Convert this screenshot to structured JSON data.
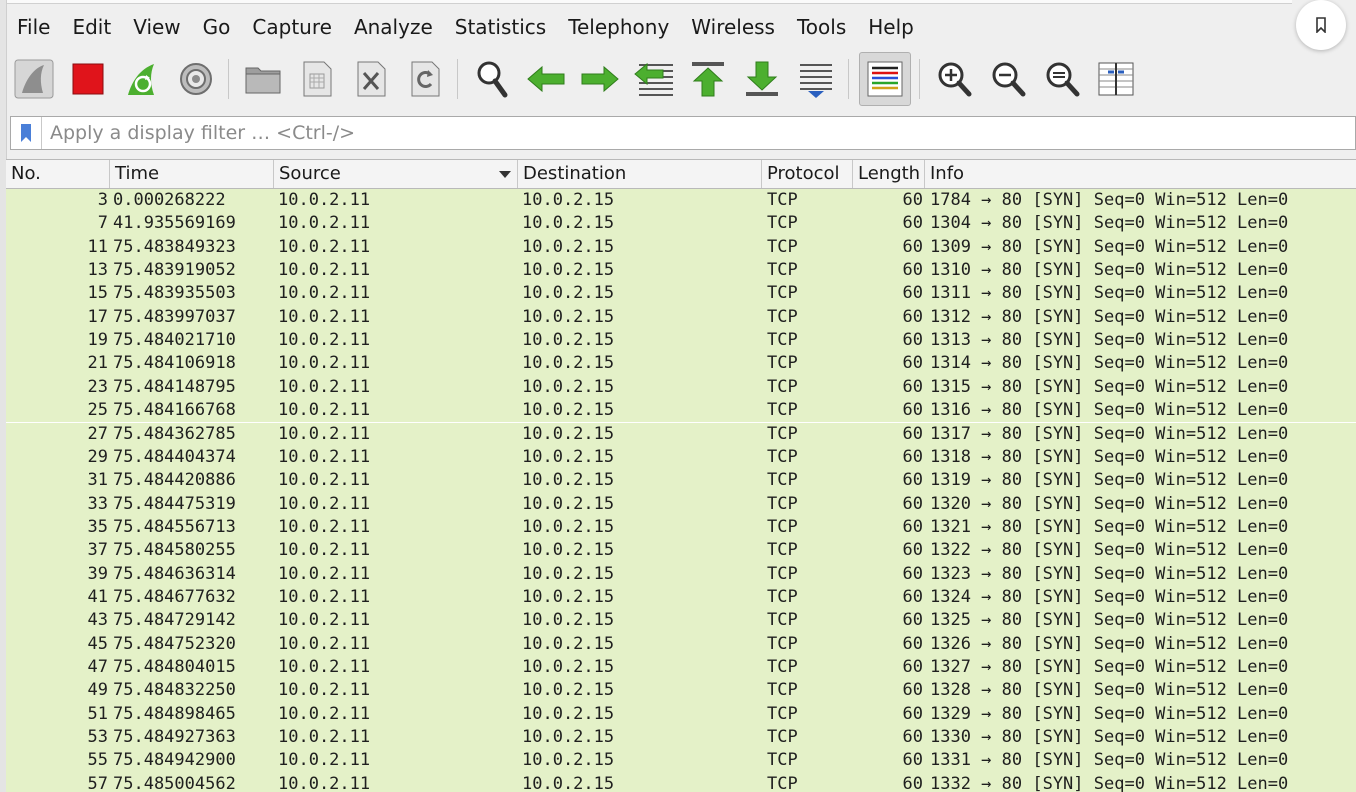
{
  "menu": [
    "File",
    "Edit",
    "View",
    "Go",
    "Capture",
    "Analyze",
    "Statistics",
    "Telephony",
    "Wireless",
    "Tools",
    "Help"
  ],
  "toolbar": {
    "buttons": [
      {
        "name": "start-capture-fin-icon",
        "sep": false
      },
      {
        "name": "stop-capture-icon",
        "sep": false
      },
      {
        "name": "restart-capture-icon",
        "sep": false
      },
      {
        "name": "capture-options-gear-icon",
        "sep": true
      },
      {
        "name": "open-file-folder-icon",
        "sep": false
      },
      {
        "name": "save-file-icon",
        "sep": false
      },
      {
        "name": "close-file-icon",
        "sep": false
      },
      {
        "name": "reload-file-icon",
        "sep": true
      },
      {
        "name": "find-packet-search-icon",
        "sep": false
      },
      {
        "name": "go-back-arrow-icon",
        "sep": false
      },
      {
        "name": "go-forward-arrow-icon",
        "sep": false
      },
      {
        "name": "go-to-packet-icon",
        "sep": false
      },
      {
        "name": "go-first-packet-icon",
        "sep": false
      },
      {
        "name": "go-last-packet-icon",
        "sep": false
      },
      {
        "name": "auto-scroll-icon",
        "sep": true
      },
      {
        "name": "colorize-icon",
        "sep": true,
        "pressed": true
      },
      {
        "name": "zoom-in-icon",
        "sep": false
      },
      {
        "name": "zoom-out-icon",
        "sep": false
      },
      {
        "name": "zoom-normal-icon",
        "sep": false
      },
      {
        "name": "resize-columns-icon",
        "sep": false
      }
    ]
  },
  "filter": {
    "placeholder": "Apply a display filter … <Ctrl-/>"
  },
  "columns": {
    "no": "No.",
    "time": "Time",
    "source": "Source",
    "destination": "Destination",
    "protocol": "Protocol",
    "length": "Length",
    "info": "Info"
  },
  "colors": {
    "row_bg": "#e4f1c8"
  },
  "packets": [
    {
      "no": "3",
      "time": "0.000268222",
      "src": "10.0.2.11",
      "dst": "10.0.2.15",
      "proto": "TCP",
      "len": "60",
      "info": "1784 → 80 [SYN] Seq=0 Win=512 Len=0"
    },
    {
      "no": "7",
      "time": "41.935569169",
      "src": "10.0.2.11",
      "dst": "10.0.2.15",
      "proto": "TCP",
      "len": "60",
      "info": "1304 → 80 [SYN] Seq=0 Win=512 Len=0"
    },
    {
      "no": "11",
      "time": "75.483849323",
      "src": "10.0.2.11",
      "dst": "10.0.2.15",
      "proto": "TCP",
      "len": "60",
      "info": "1309 → 80 [SYN] Seq=0 Win=512 Len=0"
    },
    {
      "no": "13",
      "time": "75.483919052",
      "src": "10.0.2.11",
      "dst": "10.0.2.15",
      "proto": "TCP",
      "len": "60",
      "info": "1310 → 80 [SYN] Seq=0 Win=512 Len=0"
    },
    {
      "no": "15",
      "time": "75.483935503",
      "src": "10.0.2.11",
      "dst": "10.0.2.15",
      "proto": "TCP",
      "len": "60",
      "info": "1311 → 80 [SYN] Seq=0 Win=512 Len=0"
    },
    {
      "no": "17",
      "time": "75.483997037",
      "src": "10.0.2.11",
      "dst": "10.0.2.15",
      "proto": "TCP",
      "len": "60",
      "info": "1312 → 80 [SYN] Seq=0 Win=512 Len=0"
    },
    {
      "no": "19",
      "time": "75.484021710",
      "src": "10.0.2.11",
      "dst": "10.0.2.15",
      "proto": "TCP",
      "len": "60",
      "info": "1313 → 80 [SYN] Seq=0 Win=512 Len=0"
    },
    {
      "no": "21",
      "time": "75.484106918",
      "src": "10.0.2.11",
      "dst": "10.0.2.15",
      "proto": "TCP",
      "len": "60",
      "info": "1314 → 80 [SYN] Seq=0 Win=512 Len=0"
    },
    {
      "no": "23",
      "time": "75.484148795",
      "src": "10.0.2.11",
      "dst": "10.0.2.15",
      "proto": "TCP",
      "len": "60",
      "info": "1315 → 80 [SYN] Seq=0 Win=512 Len=0"
    },
    {
      "no": "25",
      "time": "75.484166768",
      "src": "10.0.2.11",
      "dst": "10.0.2.15",
      "proto": "TCP",
      "len": "60",
      "info": "1316 → 80 [SYN] Seq=0 Win=512 Len=0"
    },
    {
      "no": "27",
      "time": "75.484362785",
      "src": "10.0.2.11",
      "dst": "10.0.2.15",
      "proto": "TCP",
      "len": "60",
      "info": "1317 → 80 [SYN] Seq=0 Win=512 Len=0"
    },
    {
      "no": "29",
      "time": "75.484404374",
      "src": "10.0.2.11",
      "dst": "10.0.2.15",
      "proto": "TCP",
      "len": "60",
      "info": "1318 → 80 [SYN] Seq=0 Win=512 Len=0"
    },
    {
      "no": "31",
      "time": "75.484420886",
      "src": "10.0.2.11",
      "dst": "10.0.2.15",
      "proto": "TCP",
      "len": "60",
      "info": "1319 → 80 [SYN] Seq=0 Win=512 Len=0"
    },
    {
      "no": "33",
      "time": "75.484475319",
      "src": "10.0.2.11",
      "dst": "10.0.2.15",
      "proto": "TCP",
      "len": "60",
      "info": "1320 → 80 [SYN] Seq=0 Win=512 Len=0"
    },
    {
      "no": "35",
      "time": "75.484556713",
      "src": "10.0.2.11",
      "dst": "10.0.2.15",
      "proto": "TCP",
      "len": "60",
      "info": "1321 → 80 [SYN] Seq=0 Win=512 Len=0"
    },
    {
      "no": "37",
      "time": "75.484580255",
      "src": "10.0.2.11",
      "dst": "10.0.2.15",
      "proto": "TCP",
      "len": "60",
      "info": "1322 → 80 [SYN] Seq=0 Win=512 Len=0"
    },
    {
      "no": "39",
      "time": "75.484636314",
      "src": "10.0.2.11",
      "dst": "10.0.2.15",
      "proto": "TCP",
      "len": "60",
      "info": "1323 → 80 [SYN] Seq=0 Win=512 Len=0"
    },
    {
      "no": "41",
      "time": "75.484677632",
      "src": "10.0.2.11",
      "dst": "10.0.2.15",
      "proto": "TCP",
      "len": "60",
      "info": "1324 → 80 [SYN] Seq=0 Win=512 Len=0"
    },
    {
      "no": "43",
      "time": "75.484729142",
      "src": "10.0.2.11",
      "dst": "10.0.2.15",
      "proto": "TCP",
      "len": "60",
      "info": "1325 → 80 [SYN] Seq=0 Win=512 Len=0"
    },
    {
      "no": "45",
      "time": "75.484752320",
      "src": "10.0.2.11",
      "dst": "10.0.2.15",
      "proto": "TCP",
      "len": "60",
      "info": "1326 → 80 [SYN] Seq=0 Win=512 Len=0"
    },
    {
      "no": "47",
      "time": "75.484804015",
      "src": "10.0.2.11",
      "dst": "10.0.2.15",
      "proto": "TCP",
      "len": "60",
      "info": "1327 → 80 [SYN] Seq=0 Win=512 Len=0"
    },
    {
      "no": "49",
      "time": "75.484832250",
      "src": "10.0.2.11",
      "dst": "10.0.2.15",
      "proto": "TCP",
      "len": "60",
      "info": "1328 → 80 [SYN] Seq=0 Win=512 Len=0"
    },
    {
      "no": "51",
      "time": "75.484898465",
      "src": "10.0.2.11",
      "dst": "10.0.2.15",
      "proto": "TCP",
      "len": "60",
      "info": "1329 → 80 [SYN] Seq=0 Win=512 Len=0"
    },
    {
      "no": "53",
      "time": "75.484927363",
      "src": "10.0.2.11",
      "dst": "10.0.2.15",
      "proto": "TCP",
      "len": "60",
      "info": "1330 → 80 [SYN] Seq=0 Win=512 Len=0"
    },
    {
      "no": "55",
      "time": "75.484942900",
      "src": "10.0.2.11",
      "dst": "10.0.2.15",
      "proto": "TCP",
      "len": "60",
      "info": "1331 → 80 [SYN] Seq=0 Win=512 Len=0"
    },
    {
      "no": "57",
      "time": "75.485004562",
      "src": "10.0.2.11",
      "dst": "10.0.2.15",
      "proto": "TCP",
      "len": "60",
      "info": "1332 → 80 [SYN] Seq=0 Win=512 Len=0"
    }
  ]
}
